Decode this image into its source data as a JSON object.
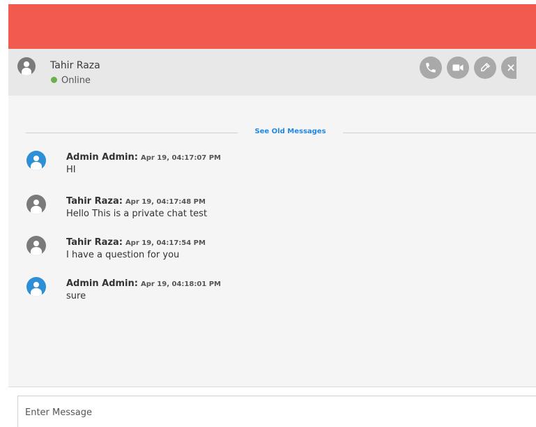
{
  "contact": {
    "name": "Tahir Raza",
    "status": "Online",
    "avatar_icon": "user-icon"
  },
  "actions": [
    {
      "name": "call-button",
      "icon": "phone-icon"
    },
    {
      "name": "video-call-button",
      "icon": "video-camera-icon"
    },
    {
      "name": "color-picker-button",
      "icon": "eyedropper-icon"
    },
    {
      "name": "close-chat-button",
      "icon": "close-icon"
    }
  ],
  "chat": {
    "see_old_messages_label": "See Old Messages",
    "messages": [
      {
        "sender": "Admin Admin:",
        "time": "Apr 19, 04:17:07 PM",
        "text": "HI",
        "role": "admin"
      },
      {
        "sender": "Tahir Raza:",
        "time": "Apr 19, 04:17:48 PM",
        "text": "Hello This is a private chat test",
        "role": "user"
      },
      {
        "sender": "Tahir Raza:",
        "time": "Apr 19, 04:17:54 PM",
        "text": "I have a question for you",
        "role": "user"
      },
      {
        "sender": "Admin Admin:",
        "time": "Apr 19, 04:18:01 PM",
        "text": "sure",
        "role": "admin"
      }
    ]
  },
  "composer": {
    "placeholder": "Enter Message",
    "value": ""
  },
  "colors": {
    "top_bar": "#f05a4f",
    "header_bg": "#e8e8e8",
    "chat_bg": "#f5f5f5",
    "online": "#6ab04c",
    "link": "#1e88e5",
    "admin_avatar": "#2d8fd5",
    "user_avatar": "#7a7a7a",
    "action_button": "#a9a9a9"
  }
}
